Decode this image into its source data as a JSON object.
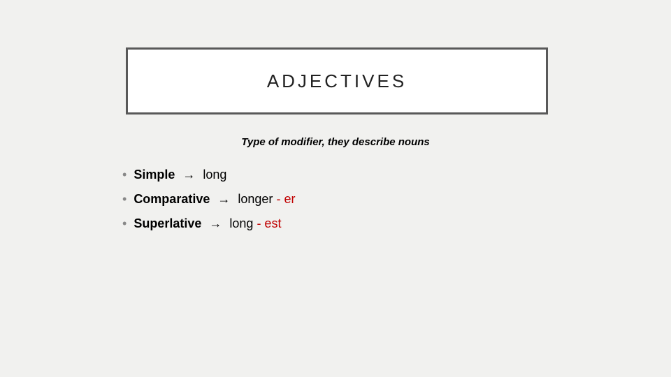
{
  "title": "ADJECTIVES",
  "subtitle": "Type of modifier, they describe nouns",
  "arrow": "→",
  "bullet": "•",
  "items": [
    {
      "term": "Simple",
      "example": "long",
      "suffix": ""
    },
    {
      "term": "Comparative",
      "example": "longer",
      "suffix": " - er"
    },
    {
      "term": "Superlative",
      "example": "long",
      "suffix": " - est"
    }
  ]
}
